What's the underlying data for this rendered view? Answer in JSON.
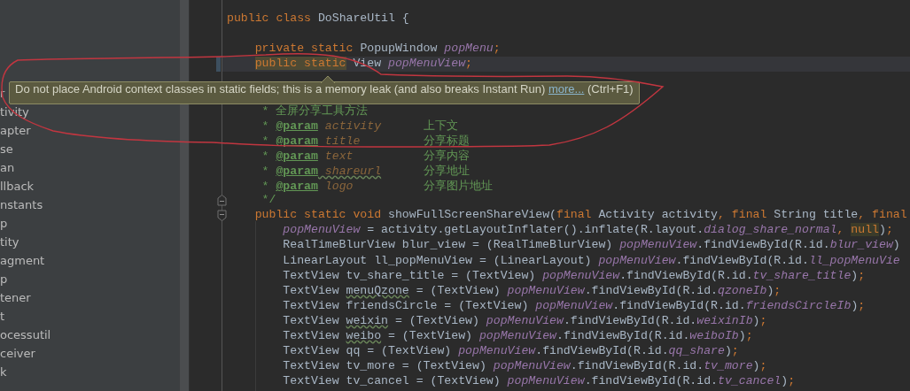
{
  "project_tree": {
    "items": [
      "r",
      "tivity",
      "apter",
      "se",
      "an",
      "llback",
      "nstants",
      "p",
      "tity",
      "agment",
      "p",
      "tener",
      "t",
      "ocessutil",
      "ceiver",
      "k"
    ]
  },
  "editor": {
    "lines": [
      {
        "kind": "code",
        "current": false,
        "tokens": [
          {
            "kind": "keyword",
            "text": "public class "
          },
          {
            "kind": "text",
            "text": "DoShareUtil {"
          }
        ]
      },
      {
        "kind": "blank"
      },
      {
        "kind": "code",
        "current": false,
        "tokens": [
          {
            "kind": "keyword",
            "text": "    private static "
          },
          {
            "kind": "text",
            "text": "PopupWindow "
          },
          {
            "kind": "field",
            "text": "popMenu"
          },
          {
            "kind": "keyword",
            "text": ";"
          }
        ]
      },
      {
        "kind": "code",
        "current": true,
        "tokens": [
          {
            "kind": "warned",
            "text": "    public static"
          },
          {
            "kind": "text",
            "text": " View "
          },
          {
            "kind": "field",
            "text": "popMenuView"
          },
          {
            "kind": "keyword",
            "text": ";"
          }
        ]
      },
      {
        "kind": "blank"
      },
      {
        "kind": "blank"
      },
      {
        "kind": "code",
        "current": false,
        "tokens": [
          {
            "kind": "comment",
            "text": "     * 全屏分享工具方法"
          }
        ]
      },
      {
        "kind": "code",
        "current": false,
        "tokens": [
          {
            "kind": "comment",
            "text": "     * "
          },
          {
            "kind": "doc-tag",
            "text": "@param"
          },
          {
            "kind": "doc-param",
            "text": " activity"
          },
          {
            "kind": "comment",
            "text": "      上下文"
          }
        ]
      },
      {
        "kind": "code",
        "current": false,
        "tokens": [
          {
            "kind": "comment",
            "text": "     * "
          },
          {
            "kind": "doc-tag",
            "text": "@param"
          },
          {
            "kind": "doc-param",
            "text": " title"
          },
          {
            "kind": "comment",
            "text": "         分享标题"
          }
        ]
      },
      {
        "kind": "code",
        "current": false,
        "tokens": [
          {
            "kind": "comment",
            "text": "     * "
          },
          {
            "kind": "doc-tag",
            "text": "@param"
          },
          {
            "kind": "doc-param",
            "text": " text"
          },
          {
            "kind": "comment",
            "text": "          分享内容"
          }
        ]
      },
      {
        "kind": "code",
        "current": false,
        "tokens": [
          {
            "kind": "comment",
            "text": "     * "
          },
          {
            "kind": "doc-tag",
            "text": "@param"
          },
          {
            "kind": "doc-param-typo",
            "text": " shareurl"
          },
          {
            "kind": "comment",
            "text": "      分享地址"
          }
        ]
      },
      {
        "kind": "code",
        "current": false,
        "tokens": [
          {
            "kind": "comment",
            "text": "     * "
          },
          {
            "kind": "doc-tag",
            "text": "@param"
          },
          {
            "kind": "doc-param",
            "text": " logo"
          },
          {
            "kind": "comment",
            "text": "          分享图片地址"
          }
        ]
      },
      {
        "kind": "code",
        "current": false,
        "tokens": [
          {
            "kind": "comment",
            "text": "     */"
          }
        ]
      },
      {
        "kind": "code",
        "current": false,
        "tokens": [
          {
            "kind": "keyword",
            "text": "    public static void "
          },
          {
            "kind": "text",
            "text": "showFullScreenShareView("
          },
          {
            "kind": "keyword",
            "text": "final "
          },
          {
            "kind": "text",
            "text": "Activity activity"
          },
          {
            "kind": "keyword",
            "text": ", final "
          },
          {
            "kind": "text",
            "text": "String title"
          },
          {
            "kind": "keyword",
            "text": ", final"
          }
        ]
      },
      {
        "kind": "code",
        "current": false,
        "tokens": [
          {
            "kind": "field",
            "text": "        popMenuView"
          },
          {
            "kind": "text",
            "text": " = activity.getLayoutInflater().inflate(R.layout."
          },
          {
            "kind": "resource",
            "text": "dialog_share_normal"
          },
          {
            "kind": "keyword",
            "text": ", "
          },
          {
            "kind": "matched",
            "text": "null"
          },
          {
            "kind": "text",
            "text": ")"
          },
          {
            "kind": "keyword",
            "text": ";"
          }
        ]
      },
      {
        "kind": "code",
        "current": false,
        "tokens": [
          {
            "kind": "text",
            "text": "        RealTimeBlurView blur_view = (RealTimeBlurView) "
          },
          {
            "kind": "field",
            "text": "popMenuView"
          },
          {
            "kind": "text",
            "text": ".findViewById(R.id."
          },
          {
            "kind": "resource",
            "text": "blur_view"
          },
          {
            "kind": "text",
            "text": ")"
          }
        ]
      },
      {
        "kind": "code",
        "current": false,
        "tokens": [
          {
            "kind": "text",
            "text": "        LinearLayout ll_popMenuView = (LinearLayout) "
          },
          {
            "kind": "field",
            "text": "popMenuView"
          },
          {
            "kind": "text",
            "text": ".findViewById(R.id."
          },
          {
            "kind": "resource",
            "text": "ll_popMenuVie"
          }
        ]
      },
      {
        "kind": "code",
        "current": false,
        "tokens": [
          {
            "kind": "text",
            "text": "        TextView tv_share_title = (TextView) "
          },
          {
            "kind": "field",
            "text": "popMenuView"
          },
          {
            "kind": "text",
            "text": ".findViewById(R.id."
          },
          {
            "kind": "resource",
            "text": "tv_share_title"
          },
          {
            "kind": "text",
            "text": ")"
          },
          {
            "kind": "keyword",
            "text": ";"
          }
        ]
      },
      {
        "kind": "code",
        "current": false,
        "tokens": [
          {
            "kind": "text",
            "text": "        TextView "
          },
          {
            "kind": "typo",
            "text": "menuQzone"
          },
          {
            "kind": "text",
            "text": " = (TextView) "
          },
          {
            "kind": "field",
            "text": "popMenuView"
          },
          {
            "kind": "text",
            "text": ".findViewById(R.id."
          },
          {
            "kind": "resource",
            "text": "qzoneIb"
          },
          {
            "kind": "text",
            "text": ")"
          },
          {
            "kind": "keyword",
            "text": ";"
          }
        ]
      },
      {
        "kind": "code",
        "current": false,
        "tokens": [
          {
            "kind": "text",
            "text": "        TextView friendsCircle = (TextView) "
          },
          {
            "kind": "field",
            "text": "popMenuView"
          },
          {
            "kind": "text",
            "text": ".findViewById(R.id."
          },
          {
            "kind": "resource",
            "text": "friendsCircleIb"
          },
          {
            "kind": "text",
            "text": ")"
          },
          {
            "kind": "keyword",
            "text": ";"
          }
        ]
      },
      {
        "kind": "code",
        "current": false,
        "tokens": [
          {
            "kind": "text",
            "text": "        TextView "
          },
          {
            "kind": "typo",
            "text": "weixin"
          },
          {
            "kind": "text",
            "text": " = (TextView) "
          },
          {
            "kind": "field",
            "text": "popMenuView"
          },
          {
            "kind": "text",
            "text": ".findViewById(R.id."
          },
          {
            "kind": "resource",
            "text": "weixinIb"
          },
          {
            "kind": "text",
            "text": ")"
          },
          {
            "kind": "keyword",
            "text": ";"
          }
        ]
      },
      {
        "kind": "code",
        "current": false,
        "tokens": [
          {
            "kind": "text",
            "text": "        TextView "
          },
          {
            "kind": "typo",
            "text": "weibo"
          },
          {
            "kind": "text",
            "text": " = (TextView) "
          },
          {
            "kind": "field",
            "text": "popMenuView"
          },
          {
            "kind": "text",
            "text": ".findViewById(R.id."
          },
          {
            "kind": "resource",
            "text": "weiboIb"
          },
          {
            "kind": "text",
            "text": ")"
          },
          {
            "kind": "keyword",
            "text": ";"
          }
        ]
      },
      {
        "kind": "code",
        "current": false,
        "tokens": [
          {
            "kind": "text",
            "text": "        TextView qq = (TextView) "
          },
          {
            "kind": "field",
            "text": "popMenuView"
          },
          {
            "kind": "text",
            "text": ".findViewById(R.id."
          },
          {
            "kind": "resource",
            "text": "qq_share"
          },
          {
            "kind": "text",
            "text": ")"
          },
          {
            "kind": "keyword",
            "text": ";"
          }
        ]
      },
      {
        "kind": "code",
        "current": false,
        "tokens": [
          {
            "kind": "text",
            "text": "        TextView tv_more = (TextView) "
          },
          {
            "kind": "field",
            "text": "popMenuView"
          },
          {
            "kind": "text",
            "text": ".findViewById(R.id."
          },
          {
            "kind": "resource",
            "text": "tv_more"
          },
          {
            "kind": "text",
            "text": ")"
          },
          {
            "kind": "keyword",
            "text": ";"
          }
        ]
      },
      {
        "kind": "code",
        "current": false,
        "tokens": [
          {
            "kind": "text",
            "text": "        TextView tv_cancel = (TextView) "
          },
          {
            "kind": "field",
            "text": "popMenuView"
          },
          {
            "kind": "text",
            "text": ".findViewById(R.id."
          },
          {
            "kind": "resource",
            "text": "tv_cancel"
          },
          {
            "kind": "text",
            "text": ")"
          },
          {
            "kind": "keyword",
            "text": ";"
          }
        ]
      }
    ]
  },
  "tooltip": {
    "message": "Do not place Android context classes in static fields; this is a memory leak (and also breaks Instant Run)",
    "link": "more...",
    "shortcut": "(Ctrl+F1)"
  }
}
